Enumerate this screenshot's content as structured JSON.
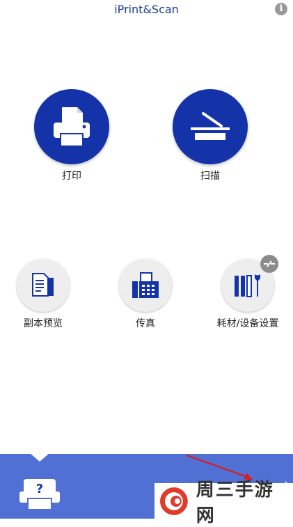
{
  "header": {
    "title": "iPrint&Scan",
    "info_icon": "info-icon"
  },
  "main_actions": [
    {
      "label": "打印",
      "icon": "printer-icon"
    },
    {
      "label": "扫描",
      "icon": "scanner-icon"
    }
  ],
  "secondary_actions": [
    {
      "label": "副本预览",
      "icon": "copy-preview-icon"
    },
    {
      "label": "传真",
      "icon": "fax-icon"
    },
    {
      "label": "耗材/设备设置",
      "icon": "supplies-settings-icon",
      "badge": "disconnected-icon"
    }
  ],
  "bottom_bar": {
    "help_icon": "printer-help-icon",
    "next_icon": "chevron-right-icon"
  },
  "watermark": {
    "text": "周三手游网",
    "logo": "watermark-logo"
  },
  "colors": {
    "brand_blue": "#1533a8",
    "bar_blue": "#5070d3",
    "annotation_red": "#e01818"
  }
}
